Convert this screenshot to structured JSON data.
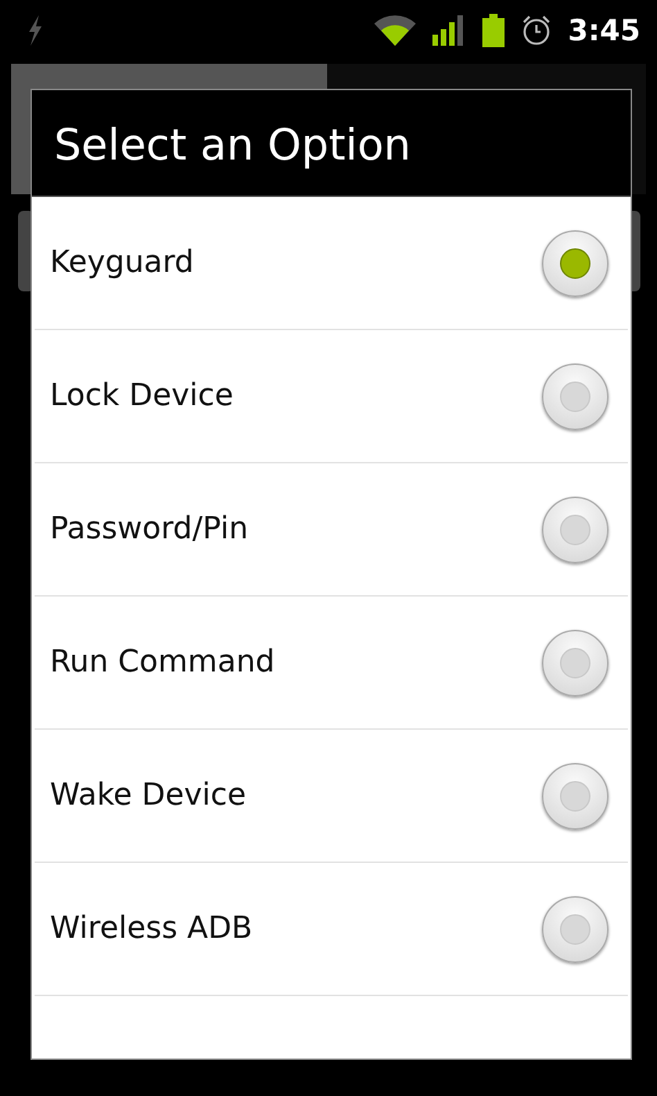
{
  "status_bar": {
    "time": "3:45"
  },
  "dialog": {
    "title": "Select an Option",
    "options": [
      {
        "label": "Keyguard",
        "selected": true
      },
      {
        "label": "Lock Device",
        "selected": false
      },
      {
        "label": "Password/Pin",
        "selected": false
      },
      {
        "label": "Run Command",
        "selected": false
      },
      {
        "label": "Wake Device",
        "selected": false
      },
      {
        "label": "Wireless ADB",
        "selected": false
      }
    ]
  }
}
